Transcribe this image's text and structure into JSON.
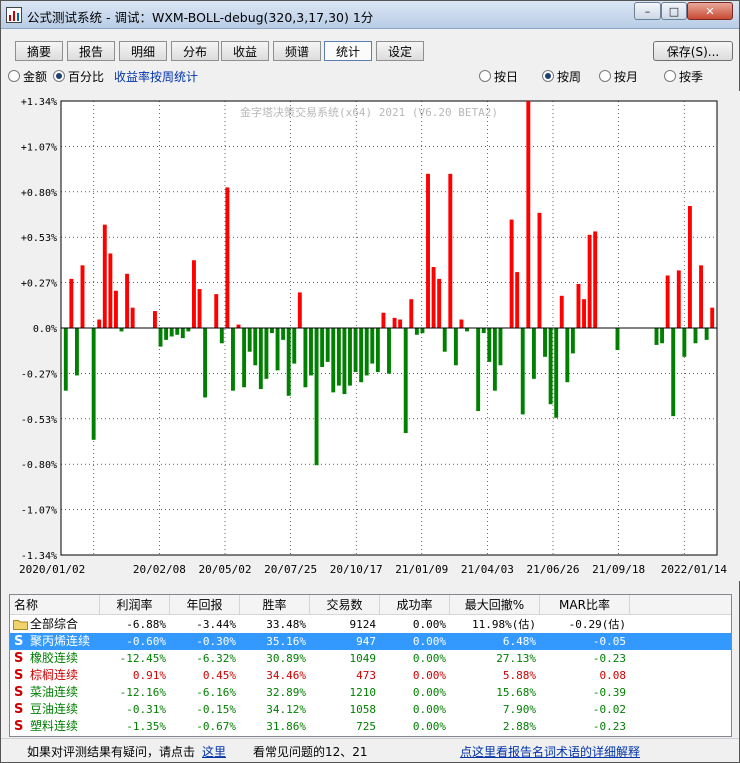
{
  "window": {
    "title": "公式测试系统 - 调试：WXM-BOLL-debug(320,3,17,30) 1分",
    "buttons": {
      "minimize": "–",
      "maximize": "□",
      "close": "✕"
    }
  },
  "tabs": [
    "摘要",
    "报告",
    "明细",
    "分布",
    "收益",
    "频谱",
    "统计",
    "设定"
  ],
  "active_tab": "统计",
  "save_button": "保存(S)...",
  "options": {
    "mode_amount": "金额",
    "mode_percent": "百分比",
    "mode_selected": "百分比",
    "weekly_link": "收益率按周统计",
    "period_day": "按日",
    "period_week": "按周",
    "period_month": "按月",
    "period_season": "按季",
    "period_selected": "按周"
  },
  "chart_data": {
    "type": "bar",
    "watermark": "金字塔决策交易系统(x64) 2021 (V6.20 BETA2)",
    "y_ticks": [
      "+1.34%",
      "+1.07%",
      "+0.80%",
      "+0.53%",
      "+0.27%",
      "0.0%",
      "-0.27%",
      "-0.53%",
      "-0.80%",
      "-1.07%",
      "-1.34%"
    ],
    "x_ticks": [
      "2020/01/02",
      "20/02/08",
      "20/05/02",
      "20/07/25",
      "20/10/17",
      "21/01/09",
      "21/04/03",
      "21/06/26",
      "21/09/18",
      "2022/01/14"
    ],
    "ylim": [
      -1.34,
      1.34
    ],
    "grid": true,
    "positive_color": "#ff0000",
    "negative_color": "#008000",
    "values": [
      -0.37,
      0.29,
      -0.28,
      0.37,
      0,
      -0.66,
      0.05,
      0.61,
      0.44,
      0.22,
      -0.02,
      0.32,
      0.12,
      0,
      0,
      0,
      0.1,
      -0.11,
      -0.07,
      -0.05,
      -0.04,
      -0.06,
      -0.02,
      0.4,
      0.23,
      -0.41,
      0,
      0.2,
      -0.09,
      0.83,
      -0.37,
      0.02,
      -0.35,
      -0.14,
      -0.22,
      -0.36,
      -0.3,
      -0.03,
      -0.25,
      -0.07,
      -0.4,
      -0.21,
      0.21,
      -0.35,
      -0.28,
      -0.81,
      -0.23,
      -0.2,
      -0.38,
      -0.34,
      -0.39,
      -0.34,
      -0.26,
      -0.32,
      -0.28,
      -0.21,
      -0.26,
      0.09,
      -0.27,
      0.06,
      0.05,
      -0.62,
      0.17,
      -0.04,
      -0.03,
      0.91,
      0.36,
      0.29,
      -0.14,
      0.91,
      -0.22,
      0.05,
      -0.02,
      0,
      -0.49,
      -0.03,
      -0.2,
      -0.37,
      -0.22,
      0,
      0.64,
      0.33,
      -0.51,
      1.34,
      -0.3,
      0.68,
      -0.17,
      -0.45,
      -0.53,
      0.19,
      -0.32,
      -0.15,
      0.26,
      0.17,
      0.55,
      0.57,
      0,
      0,
      0,
      -0.13,
      0,
      0,
      0,
      0,
      0,
      0,
      -0.1,
      -0.09,
      0.31,
      -0.52,
      0.34,
      -0.17,
      0.72,
      -0.09,
      0.37,
      -0.07,
      0.12
    ]
  },
  "table": {
    "headers": [
      "名称",
      "利润率",
      "年回报",
      "胜率",
      "交易数",
      "成功率",
      "最大回撤%",
      "MAR比率"
    ],
    "rows": [
      {
        "name": "全部综合",
        "icon": "folder",
        "profit": "-6.88%",
        "annual": "-3.44%",
        "win": "33.48%",
        "trades": "9124",
        "success": "0.00%",
        "drawdown": "11.98%(估)",
        "mar": "-0.29(估)",
        "selected": false,
        "color": "#000000"
      },
      {
        "name": "聚丙烯连续",
        "icon": "S",
        "profit": "-0.60%",
        "annual": "-0.30%",
        "win": "35.16%",
        "trades": "947",
        "success": "0.00%",
        "drawdown": "6.48%",
        "mar": "-0.05",
        "selected": true,
        "color": "#ffffff"
      },
      {
        "name": "橡胶连续",
        "icon": "S",
        "profit": "-12.45%",
        "annual": "-6.32%",
        "win": "30.89%",
        "trades": "1049",
        "success": "0.00%",
        "drawdown": "27.13%",
        "mar": "-0.23",
        "selected": false,
        "color": "#008000"
      },
      {
        "name": "棕榈连续",
        "icon": "S",
        "profit": "0.91%",
        "annual": "0.45%",
        "win": "34.46%",
        "trades": "473",
        "success": "0.00%",
        "drawdown": "5.88%",
        "mar": "0.08",
        "selected": false,
        "color": "#d00000"
      },
      {
        "name": "菜油连续",
        "icon": "S",
        "profit": "-12.16%",
        "annual": "-6.16%",
        "win": "32.89%",
        "trades": "1210",
        "success": "0.00%",
        "drawdown": "15.68%",
        "mar": "-0.39",
        "selected": false,
        "color": "#008000"
      },
      {
        "name": "豆油连续",
        "icon": "S",
        "profit": "-0.31%",
        "annual": "-0.15%",
        "win": "34.12%",
        "trades": "1058",
        "success": "0.00%",
        "drawdown": "7.90%",
        "mar": "-0.02",
        "selected": false,
        "color": "#008000"
      },
      {
        "name": "塑料连续",
        "icon": "S",
        "profit": "-1.35%",
        "annual": "-0.67%",
        "win": "31.86%",
        "trades": "725",
        "success": "0.00%",
        "drawdown": "2.88%",
        "mar": "-0.23",
        "selected": false,
        "color": "#008000"
      }
    ]
  },
  "status": {
    "question_text": "如果对评测结果有疑问，请点击",
    "here_link": "这里",
    "faq_text": "看常见问题的12、21",
    "glossary_link": "点这里看报告名词术语的详细解释"
  }
}
